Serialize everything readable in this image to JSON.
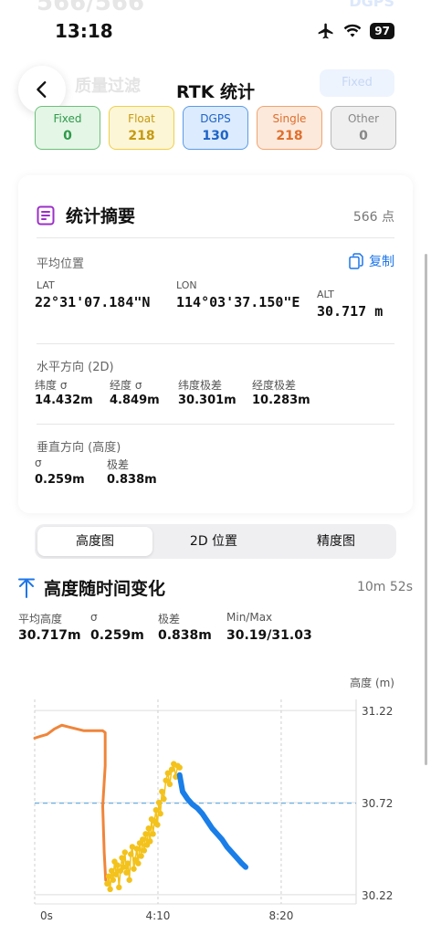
{
  "status_bar": {
    "time": "13:18",
    "battery": "97",
    "ghost_left": "566/566",
    "ghost_right": "DGPS"
  },
  "nav": {
    "title": "RTK 统计",
    "ghost_filter": "质量过滤",
    "ghost_button": "Fixed"
  },
  "quality_tiles": [
    {
      "label": "Fixed",
      "value": "0",
      "bg": "#e4f6e6",
      "border": "#6cc07a",
      "text": "#2f9a4a"
    },
    {
      "label": "Float",
      "value": "218",
      "bg": "#fdf6d6",
      "border": "#efcf4a",
      "text": "#c59a12"
    },
    {
      "label": "DGPS",
      "value": "130",
      "bg": "#dcebfd",
      "border": "#5a9be8",
      "text": "#1e63c7"
    },
    {
      "label": "Single",
      "value": "218",
      "bg": "#fde9dc",
      "border": "#f0a470",
      "text": "#de6f2c"
    },
    {
      "label": "Other",
      "value": "0",
      "bg": "#efefef",
      "border": "#b8b8b8",
      "text": "#888888"
    }
  ],
  "summary": {
    "title": "统计摘要",
    "count": "566 点",
    "avg_position_label": "平均位置",
    "copy_label": "复制",
    "lat_label": "LAT",
    "lat_value": "22°31'07.184\"N",
    "lon_label": "LON",
    "lon_value": "114°03'37.150\"E",
    "alt_label": "ALT",
    "alt_value": "30.717 m",
    "horizontal_label": "水平方向 (2D)",
    "horizontal": [
      {
        "label": "纬度 σ",
        "value": "14.432m"
      },
      {
        "label": "经度 σ",
        "value": "4.849m"
      },
      {
        "label": "纬度极差",
        "value": "30.301m"
      },
      {
        "label": "经度极差",
        "value": "10.283m"
      }
    ],
    "vertical_label": "垂直方向 (高度)",
    "vertical": [
      {
        "label": "σ",
        "value": "0.259m"
      },
      {
        "label": "极差",
        "value": "0.838m"
      }
    ]
  },
  "tabs": [
    {
      "label": "高度图",
      "active": true
    },
    {
      "label": "2D 位置",
      "active": false
    },
    {
      "label": "精度图",
      "active": false
    }
  ],
  "chart_section": {
    "title": "高度随时间变化",
    "duration": "10m 52s",
    "stats": [
      {
        "label": "平均高度",
        "value": "30.717m"
      },
      {
        "label": "σ",
        "value": "0.259m"
      },
      {
        "label": "极差",
        "value": "0.838m"
      },
      {
        "label": "Min/Max",
        "value": "30.19/31.03"
      }
    ]
  },
  "chart_data": {
    "type": "line",
    "ylabel": "高度 (m)",
    "x_ticks": [
      "0s",
      "4:10",
      "8:20"
    ],
    "x_tick_seconds": [
      0,
      250,
      500
    ],
    "x_range_seconds": [
      0,
      652
    ],
    "y_ticks": [
      30.22,
      30.72,
      31.22
    ],
    "ylim": [
      30.17,
      31.28
    ],
    "mean_line": 30.717,
    "y_axis_side": "right",
    "grid": true,
    "series": [
      {
        "color": "#f0853a",
        "style": "line",
        "points": [
          [
            0,
            31.07
          ],
          [
            12,
            31.08
          ],
          [
            25,
            31.09
          ],
          [
            40,
            31.12
          ],
          [
            55,
            31.14
          ],
          [
            70,
            31.13
          ],
          [
            85,
            31.12
          ],
          [
            100,
            31.11
          ],
          [
            120,
            31.11
          ],
          [
            138,
            31.11
          ],
          [
            143,
            31.1
          ],
          [
            143,
            30.92
          ],
          [
            138,
            30.7
          ],
          [
            141,
            30.45
          ],
          [
            144,
            30.3
          ]
        ]
      },
      {
        "color": "#f3c21c",
        "style": "dots",
        "points": [
          [
            147,
            30.28
          ],
          [
            150,
            30.32
          ],
          [
            153,
            30.25
          ],
          [
            156,
            30.35
          ],
          [
            159,
            30.3
          ],
          [
            162,
            30.4
          ],
          [
            165,
            30.33
          ],
          [
            168,
            30.38
          ],
          [
            171,
            30.26
          ],
          [
            174,
            30.35
          ],
          [
            177,
            30.42
          ],
          [
            180,
            30.37
          ],
          [
            183,
            30.45
          ],
          [
            186,
            30.34
          ],
          [
            189,
            30.39
          ],
          [
            192,
            30.3
          ],
          [
            195,
            30.44
          ],
          [
            198,
            30.48
          ],
          [
            201,
            30.36
          ],
          [
            204,
            30.41
          ],
          [
            207,
            30.47
          ],
          [
            210,
            30.39
          ],
          [
            213,
            30.5
          ],
          [
            216,
            30.43
          ],
          [
            219,
            30.52
          ],
          [
            222,
            30.46
          ],
          [
            225,
            30.55
          ],
          [
            228,
            30.49
          ],
          [
            231,
            30.58
          ],
          [
            234,
            30.51
          ],
          [
            237,
            30.63
          ],
          [
            240,
            30.55
          ],
          [
            243,
            30.62
          ],
          [
            246,
            30.68
          ],
          [
            249,
            30.6
          ],
          [
            252,
            30.72
          ],
          [
            255,
            30.66
          ],
          [
            258,
            30.78
          ],
          [
            262,
            30.74
          ],
          [
            266,
            30.84
          ],
          [
            270,
            30.88
          ],
          [
            274,
            30.82
          ],
          [
            278,
            30.9
          ],
          [
            282,
            30.93
          ],
          [
            286,
            30.86
          ],
          [
            290,
            30.92
          ],
          [
            294,
            30.91
          ]
        ]
      },
      {
        "color": "#1a7ee8",
        "style": "line",
        "points": [
          [
            294,
            30.87
          ],
          [
            300,
            30.78
          ],
          [
            310,
            30.74
          ],
          [
            320,
            30.71
          ],
          [
            330,
            30.69
          ],
          [
            340,
            30.66
          ],
          [
            350,
            30.62
          ],
          [
            360,
            30.58
          ],
          [
            370,
            30.55
          ],
          [
            380,
            30.52
          ],
          [
            390,
            30.48
          ],
          [
            400,
            30.45
          ],
          [
            410,
            30.42
          ],
          [
            420,
            30.39
          ],
          [
            428,
            30.37
          ]
        ]
      }
    ]
  }
}
